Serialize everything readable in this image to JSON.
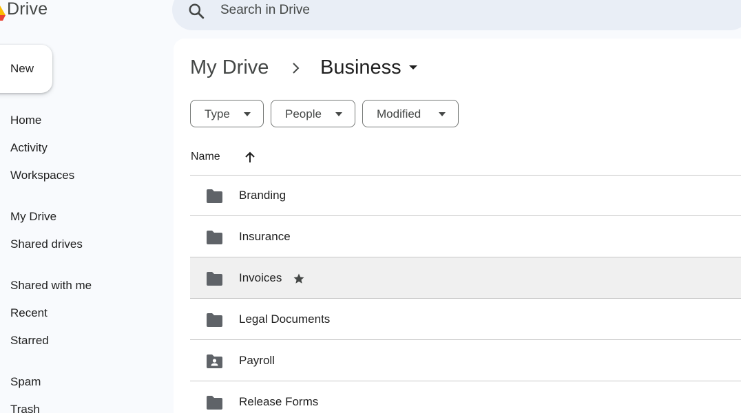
{
  "header": {
    "app_name": "Drive",
    "search_placeholder": "Search in Drive"
  },
  "sidebar": {
    "new_label": "New",
    "items": [
      {
        "label": "Home"
      },
      {
        "label": "Activity"
      },
      {
        "label": "Workspaces"
      },
      {
        "label": "My Drive"
      },
      {
        "label": "Shared drives"
      },
      {
        "label": "Shared with me"
      },
      {
        "label": "Recent"
      },
      {
        "label": "Starred"
      },
      {
        "label": "Spam"
      },
      {
        "label": "Trash"
      }
    ]
  },
  "breadcrumb": {
    "root": "My Drive",
    "current": "Business"
  },
  "filters": [
    {
      "label": "Type"
    },
    {
      "label": "People"
    },
    {
      "label": "Modified"
    }
  ],
  "list": {
    "column_name": "Name",
    "sort_icon": "arrow-up-icon",
    "rows": [
      {
        "name": "Branding",
        "icon": "folder-icon",
        "starred": false,
        "selected": false
      },
      {
        "name": "Insurance",
        "icon": "folder-icon",
        "starred": false,
        "selected": false
      },
      {
        "name": "Invoices",
        "icon": "folder-icon",
        "starred": true,
        "selected": true
      },
      {
        "name": "Legal Documents",
        "icon": "folder-icon",
        "starred": false,
        "selected": false
      },
      {
        "name": "Payroll",
        "icon": "shared-folder-icon",
        "starred": false,
        "selected": false
      },
      {
        "name": "Release Forms",
        "icon": "folder-icon",
        "starred": false,
        "selected": false
      }
    ]
  },
  "colors": {
    "background": "#f8fafd",
    "search_bg": "#e9eef6",
    "panel": "#ffffff",
    "selected_row": "#f0f0f0",
    "icon": "#5f6368"
  }
}
